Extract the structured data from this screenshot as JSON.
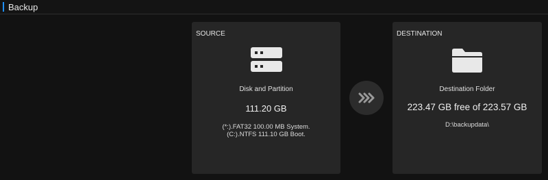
{
  "header": {
    "title": "Backup",
    "accent_color": "#1e90ff"
  },
  "source": {
    "label": "SOURCE",
    "icon": "disk-drive-icon",
    "subtitle": "Disk and Partition",
    "size": "111.20 GB",
    "details": [
      "(*:).FAT32 100.00 MB System.",
      "(C:).NTFS 111.10 GB Boot."
    ]
  },
  "arrow": {
    "icon": "triple-chevron-right-icon"
  },
  "destination": {
    "label": "DESTINATION",
    "icon": "folder-icon",
    "subtitle": "Destination Folder",
    "size": "223.47 GB free of 223.57 GB",
    "path": "D:\\backupdata\\"
  }
}
